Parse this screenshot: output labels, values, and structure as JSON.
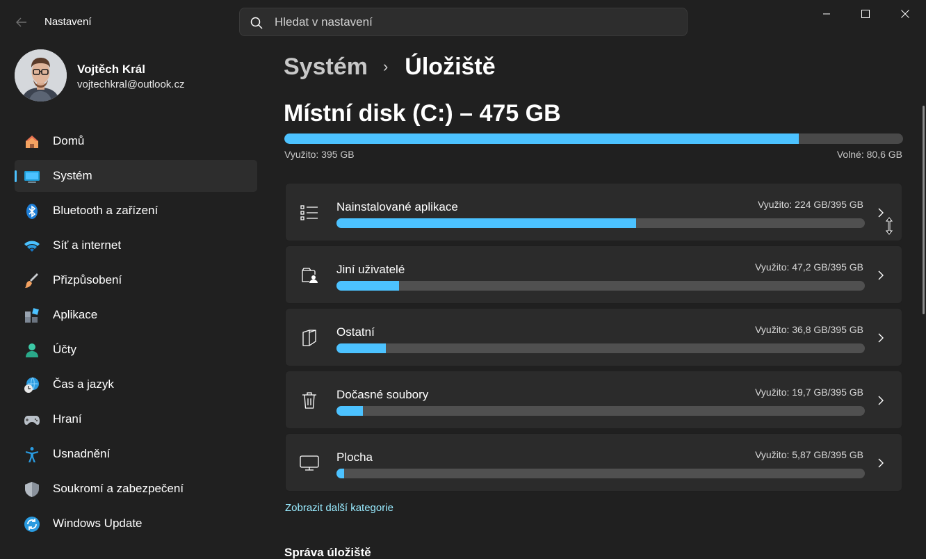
{
  "app": {
    "title": "Nastavení"
  },
  "search": {
    "placeholder": "Hledat v nastavení"
  },
  "user": {
    "name": "Vojtěch Král",
    "email": "vojtechkral@outlook.cz"
  },
  "nav": {
    "items": [
      {
        "label": "Domů",
        "icon": "home-icon"
      },
      {
        "label": "Systém",
        "icon": "system-icon",
        "active": true
      },
      {
        "label": "Bluetooth a zařízení",
        "icon": "bluetooth-icon"
      },
      {
        "label": "Síť a internet",
        "icon": "wifi-icon"
      },
      {
        "label": "Přizpůsobení",
        "icon": "brush-icon"
      },
      {
        "label": "Aplikace",
        "icon": "apps-icon"
      },
      {
        "label": "Účty",
        "icon": "account-icon"
      },
      {
        "label": "Čas a jazyk",
        "icon": "time-language-icon"
      },
      {
        "label": "Hraní",
        "icon": "gamepad-icon"
      },
      {
        "label": "Usnadnění",
        "icon": "accessibility-icon"
      },
      {
        "label": "Soukromí a zabezpečení",
        "icon": "shield-icon"
      },
      {
        "label": "Windows Update",
        "icon": "update-icon"
      }
    ]
  },
  "breadcrumb": {
    "parent": "Systém",
    "separator": "›",
    "current": "Úložiště"
  },
  "disk": {
    "title": "Místní disk (C:) – 475 GB",
    "used_label": "Využito: 395 GB",
    "free_label": "Volné: 80,6 GB",
    "used_fraction": 0.831
  },
  "categories": [
    {
      "name": "Nainstalované aplikace",
      "usage": "Využito: 224 GB/395 GB",
      "fraction": 0.567,
      "icon": "apps-list-icon"
    },
    {
      "name": "Jiní uživatelé",
      "usage": "Využito: 47,2 GB/395 GB",
      "fraction": 0.119,
      "icon": "other-users-icon"
    },
    {
      "name": "Ostatní",
      "usage": "Využito: 36,8 GB/395 GB",
      "fraction": 0.093,
      "icon": "document-icon"
    },
    {
      "name": "Dočasné soubory",
      "usage": "Využito: 19,7 GB/395 GB",
      "fraction": 0.05,
      "icon": "trash-icon"
    },
    {
      "name": "Plocha",
      "usage": "Využito: 5,87 GB/395 GB",
      "fraction": 0.015,
      "icon": "desktop-icon"
    }
  ],
  "more_link": "Zobrazit další kategorie",
  "section_title": "Správa úložiště",
  "colors": {
    "accent": "#4cc2ff",
    "background": "#202020",
    "card": "#2b2b2b",
    "link": "#99ebff"
  }
}
